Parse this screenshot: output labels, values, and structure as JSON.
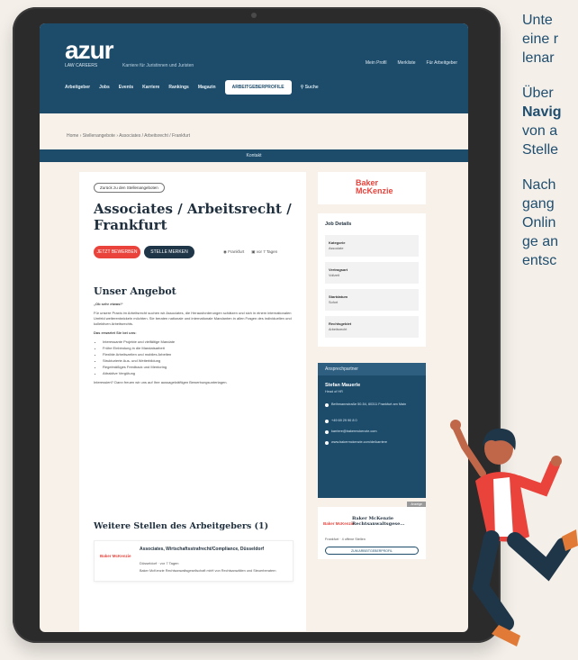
{
  "site": {
    "logo": "azur",
    "logo_sub": "LAW CAREERS",
    "tagline": "Karriere für Juristinnen und Juristen",
    "utility": [
      "Mein Profil",
      "Merkliste",
      "Für Arbeitgeber"
    ],
    "nav": [
      "Arbeitgeber",
      "Jobs",
      "Events",
      "Karriere",
      "Rankings",
      "Magazin"
    ],
    "nav_cta": "ARBEITGEBERPROFILE",
    "search": "Suche"
  },
  "breadcrumb": "Home › Stellenangebote › Associates / Arbeitsrecht / Frankfurt",
  "info_bar": "Kontakt",
  "job": {
    "back": "Zurück zu den Stellenangeboten",
    "title": "Associates / Arbeitsrecht / Frankfurt",
    "apply": "JETZT BEWERBEN",
    "favorite": "STELLE MERKEN",
    "meta_place": "Frankfurt",
    "meta_date": "vor 7 Tagen",
    "section_title": "Unser Angebot",
    "paragraphs": [
      "„Ob sehr etwas!“",
      "Für unsere Praxis im Arbeitsrecht suchen wir Associates, die Herausforderungen schätzen und sich in einem internationalen Umfeld weiterentwickeln möchten. Sie beraten nationale und internationale Mandanten in allen Fragen des individuellen und kollektiven Arbeitsrechts.",
      "Das erwartet Sie bei uns:"
    ],
    "bullets": [
      "Interessante Projekte und vielfältige Mandate",
      "Frühe Einbindung in die Mandatsarbeit",
      "Flexible Arbeitszeiten und mobiles Arbeiten",
      "Strukturierte Aus- und Weiterbildung",
      "Regelmäßiges Feedback und Mentoring",
      "Attraktive Vergütung"
    ],
    "closing": "Interessiert? Dann freuen wir uns auf Ihre aussagekräftigen Bewerbungsunterlagen."
  },
  "more": {
    "title": "Weitere Stellen des Arbeitgebers (1)",
    "card_logo": "Baker McKenzie",
    "card_title": "Associates, Wirtschaftsstrafrecht/Compliance, Düsseldorf",
    "card_meta": "Düsseldorf · vor 7 Tagen",
    "card_addr": "Baker McKenzie Rechtsanwaltsgesellschaft mbH von Rechtsanwälten und Steuerberatern"
  },
  "sidebar": {
    "logo_text_1": "Baker",
    "logo_text_2": "McKenzie",
    "details_title": "Job Details",
    "details": [
      {
        "k": "Kategorie",
        "v": "Associate"
      },
      {
        "k": "Vertragsart",
        "v": "Vollzeit"
      },
      {
        "k": "Startdatum",
        "v": "Sofort"
      },
      {
        "k": "Rechtsgebiet",
        "v": "Arbeitsrecht"
      }
    ],
    "contact_header": "Ansprechpartner",
    "contact_name": "Stefan Mauerle",
    "contact_role": "Head of HR",
    "contact_lines": [
      "Bethmannstraße 50-54, 60311 Frankfurt am Main",
      "+49 69 29 90 8 0",
      "karriere@bakermckenzie.com",
      "www.bakermckenzie.com/de/karriere"
    ],
    "emp_badge": "Anzeige",
    "emp_logo": "Baker McKenzie",
    "emp_name": "Baker McKenzie Rechtsanwaltsgese...",
    "emp_meta": "Frankfurt · 4 offene Stellen",
    "emp_btn": "ZUM ARBEITGEBERPROFIL"
  },
  "side_text": {
    "p1": [
      "Unte",
      "eine r",
      "lenar"
    ],
    "p2_a": "Über",
    "p2_b": "Navig",
    "p2_c": [
      "von a",
      "Stelle"
    ],
    "p3": [
      "Nach",
      "gang",
      "Onlin",
      "ge an",
      "entsc"
    ]
  },
  "colors": {
    "brand": "#1d4c6b",
    "accent": "#e9433c",
    "background": "#f4efe9"
  }
}
